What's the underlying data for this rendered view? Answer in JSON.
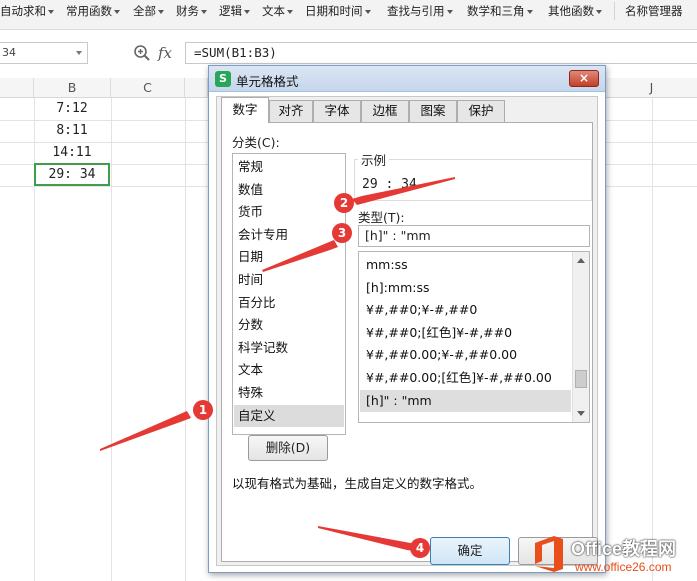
{
  "ribbon": {
    "items": [
      "自动求和",
      "常用函数",
      "全部",
      "财务",
      "逻辑",
      "文本",
      "日期和时间",
      "查找与引用",
      "数学和三角",
      "其他函数",
      "名称管理器"
    ]
  },
  "formula_bar": {
    "name_box": "34",
    "fx": "fx",
    "formula": "=SUM(B1:B3)"
  },
  "grid": {
    "columns": [
      "B",
      "C",
      "J"
    ],
    "cells": [
      "7:12",
      "8:11",
      "14:11",
      "29: 34"
    ]
  },
  "dialog": {
    "title": "单元格格式",
    "close": "×",
    "tabs": [
      "数字",
      "对齐",
      "字体",
      "边框",
      "图案",
      "保护"
    ],
    "category_label": "分类(C):",
    "categories": [
      "常规",
      "数值",
      "货币",
      "会计专用",
      "日期",
      "时间",
      "百分比",
      "分数",
      "科学记数",
      "文本",
      "特殊",
      "自定义"
    ],
    "sample_label": "示例",
    "sample_value": "29 : 34",
    "type_label": "类型(T):",
    "type_value": "[h]\" : \"mm",
    "type_list": [
      "mm:ss",
      "[h]:mm:ss",
      "¥#,##0;¥-#,##0",
      "¥#,##0;[红色]¥-#,##0",
      "¥#,##0.00;¥-#,##0.00",
      "¥#,##0.00;[红色]¥-#,##0.00",
      "[h]\" : \"mm"
    ],
    "delete_button": "删除(D)",
    "description": "以现有格式为基础，生成自定义的数字格式。",
    "ok_button": "确定"
  },
  "annotations": {
    "badges": [
      "1",
      "2",
      "3",
      "4"
    ],
    "color": "#e53935"
  },
  "watermark": {
    "title": "Office教程网",
    "site": "www.office26.com"
  }
}
